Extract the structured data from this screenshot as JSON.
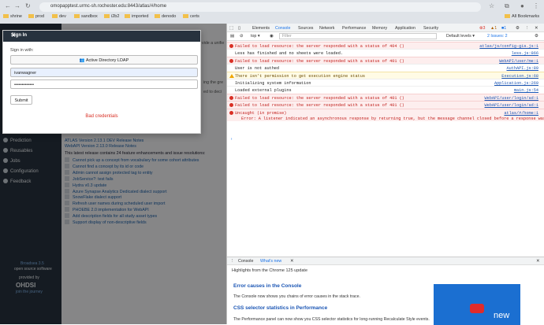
{
  "browser": {
    "url": "omopapptest.urmc-sh.rochester.edu:8443/atlas/#/home",
    "all_bookmarks": "All Bookmarks",
    "bookmarks": [
      "shrine",
      "prod",
      "dev",
      "sandbox",
      "i2b2",
      "imported",
      "denodo",
      "certs"
    ]
  },
  "sidebar": {
    "items": [
      "Prediction",
      "Reusables",
      "Jobs",
      "Configuration",
      "Feedback"
    ],
    "footer_version": "Broadsea 3.5",
    "footer_line": "open source software",
    "provided_by": "provided by",
    "ohdsi": "OHDSI",
    "join": "join the journey"
  },
  "page": {
    "header_partial": "vide a unifie",
    "header_partial2": "ing the gre",
    "header_partial3": "ed to deci",
    "release1": "ATLAS Version 2.13.1 DEV Release Notes",
    "release2": "WebAPI Version 2.13.0 Release Notes",
    "release_intro": "This latest release contains 24 feature enhancements and issue resolutions:",
    "items": [
      "Cannot pick up a concept from vocabulary for some cohort attributes",
      "Cannot find a concept by its id or code",
      "Admin cannot assign protected tag to entity",
      "JobService?: test fails",
      "Hydra v0.3 update",
      "Azure Synapse Analytics Dedicated dialect support",
      "SnowFlake dialect support",
      "Refresh user names during scheduled user import",
      "PHOEBE 2.0 implementation for WebAPI",
      "Add description fields for all study asset types",
      "Support display of non-descriptive fields"
    ]
  },
  "dialog": {
    "title": "Sign In",
    "sign_with": "Sign in with:",
    "ad_button": "Active Directory LDAP",
    "username": "ivanwagner",
    "password": "•••••••••••••",
    "submit": "Submit",
    "error": "Bad credentials"
  },
  "devtools": {
    "tabs": [
      "Elements",
      "Console",
      "Sources",
      "Network",
      "Performance",
      "Memory",
      "Application",
      "Security"
    ],
    "errors_count": "3",
    "warnings_count": "1",
    "issues_count": "1",
    "context": "top",
    "filter": "Filter",
    "levels": "Default levels",
    "issues": "2 Issues: 2",
    "logs": [
      {
        "type": "err",
        "msg": "Failed to load resource: the server responded with a status of 404 ()",
        "src": "atlas/js/config-gis.js:1"
      },
      {
        "type": "info",
        "msg": "Less has finished and no sheets were loaded.",
        "src": "less.js:866"
      },
      {
        "type": "err",
        "msg": "Failed to load resource: the server responded with a status of 401 ()",
        "src": "WebAPI/user/me:1"
      },
      {
        "type": "info",
        "msg": "User is not authed",
        "src": "AuthAPI.js:89"
      },
      {
        "type": "warn",
        "msg": "There isn't permission to get execution engine status",
        "src": "Execution.js:68"
      },
      {
        "type": "info",
        "msg": "Initializing system information",
        "src": "Application.js:269"
      },
      {
        "type": "info",
        "msg": "Loaded external plugins",
        "src": "main.js:54"
      },
      {
        "type": "err",
        "msg": "Failed to load resource: the server responded with a status of 401 ()",
        "src": "WebAPI/user/login/ad:1"
      },
      {
        "type": "err",
        "msg": "Failed to load resource: the server responded with a status of 401 ()",
        "src": "WebAPI/user/login/ad:1"
      },
      {
        "type": "err",
        "msg": "Uncaught (in promise)",
        "src": "atlas/#/home:1"
      }
    ],
    "promise_detail": "Error: A listener indicated an asynchronous response by returning true, but the message channel closed before a response was received",
    "drawer_tabs": [
      "Console",
      "What's new"
    ],
    "highlights": "Highlights from the Chrome 125 update",
    "h1": "Error causes in the Console",
    "p1": "The Console now shows you chains of error causes in the stack trace.",
    "h2": "CSS selector statistics in Performance",
    "p2": "The Performance panel can now show you CSS selector statistics for long-running Recalculate Style events.",
    "new_label": "new"
  },
  "colors": {
    "accent": "#1a73e8",
    "error": "#d93025",
    "sidebar": "#27323e"
  }
}
